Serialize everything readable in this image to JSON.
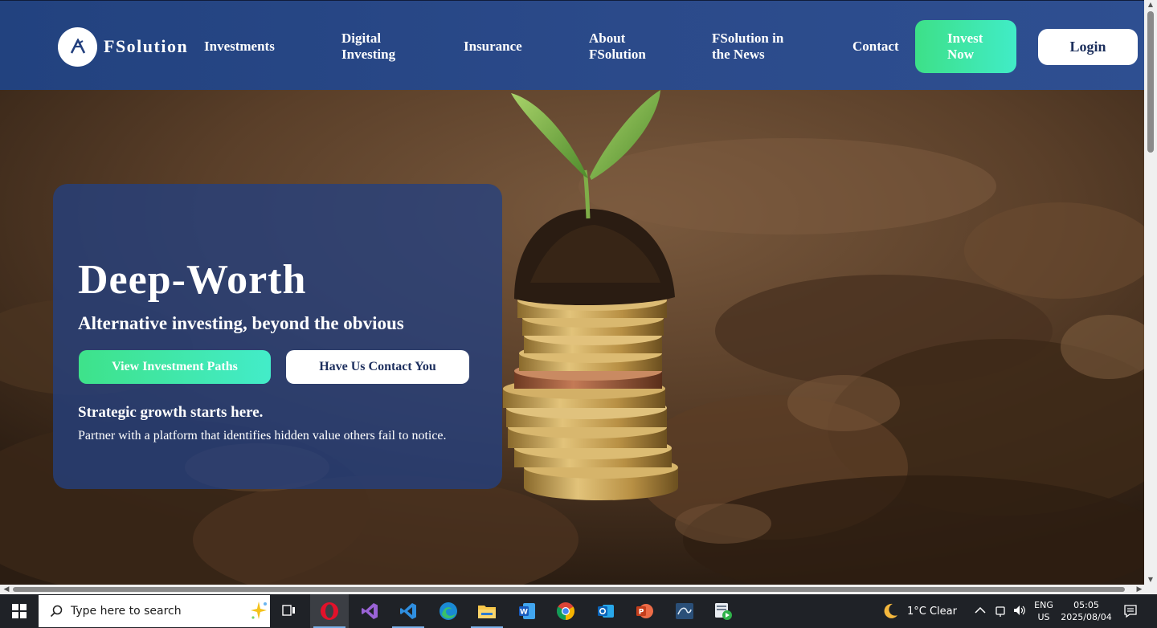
{
  "colors": {
    "nav_bg": "#2b4a8a",
    "accent_gradient_start": "#3de088",
    "accent_gradient_end": "#41ecc7",
    "card_bg": "rgba(36,64,128,0.78)",
    "taskbar_bg": "#1f2227"
  },
  "header": {
    "brand": "FSolution",
    "nav": [
      "Investments",
      "Digital\nInvesting",
      "Insurance",
      "About\nFSolution",
      "FSolution in\nthe News",
      "Contact"
    ],
    "invest_button": "Invest\nNow",
    "login_button": "Login"
  },
  "hero": {
    "title": "Deep-Worth",
    "subtitle": "Alternative investing, beyond the obvious",
    "primary_button": "View Investment Paths",
    "secondary_button": "Have Us Contact You",
    "tagline": "Strategic growth starts here.",
    "description": "Partner with a platform that identifies hidden value others fail to notice."
  },
  "taskbar": {
    "search_placeholder": "Type here to search",
    "apps": [
      "task-view",
      "opera",
      "visual-studio",
      "vs-code",
      "edge",
      "file-explorer",
      "word",
      "chrome",
      "outlook",
      "powerpoint",
      "mysql-workbench",
      "media-player"
    ],
    "weather": "1°C  Clear",
    "lang_top": "ENG",
    "lang_bottom": "US",
    "time": "05:05",
    "date": "2025/08/04"
  }
}
